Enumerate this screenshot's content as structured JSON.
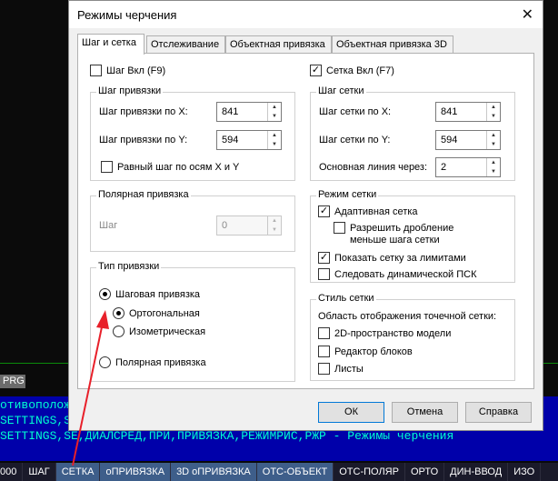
{
  "background": {
    "prg_tab": "PRG",
    "cmd_lines": [
      "отивополож",
      "SETTINGS,SE",
      "SETTINGS,SЕ,ДИАЛСРЕД,ПРИ,ПРИВЯЗКА,РЕЖИМРИС,РЖР - Режимы черчения"
    ],
    "status_items": [
      {
        "label": "000",
        "active": false
      },
      {
        "label": "ШАГ",
        "active": false
      },
      {
        "label": "СЕТКА",
        "active": true
      },
      {
        "label": "оПРИВЯЗКА",
        "active": true
      },
      {
        "label": "3D оПРИВЯЗКА",
        "active": true
      },
      {
        "label": "ОТС-ОБЪЕКТ",
        "active": true
      },
      {
        "label": "ОТС-ПОЛЯР",
        "active": false
      },
      {
        "label": "ОРТО",
        "active": false
      },
      {
        "label": "ДИН-ВВОД",
        "active": false
      },
      {
        "label": "ИЗО",
        "active": false
      }
    ]
  },
  "dialog": {
    "title": "Режимы черчения",
    "close_icon": "close-icon",
    "tabs": [
      {
        "label": "Шаг и сетка",
        "active": true
      },
      {
        "label": "Отслеживание",
        "active": false
      },
      {
        "label": "Объектная привязка",
        "active": false
      },
      {
        "label": "Объектная привязка 3D",
        "active": false
      }
    ],
    "snap_on": {
      "label": "Шаг Вкл (F9)",
      "checked": false
    },
    "grid_on": {
      "label": "Сетка Вкл (F7)",
      "checked": true
    },
    "snap_group": {
      "title": "Шаг привязки",
      "x_label": "Шаг привязки по X:",
      "x_value": "841",
      "y_label": "Шаг привязки по Y:",
      "y_value": "594",
      "equal_label": "Равный шаг по осям X и Y",
      "equal_checked": false
    },
    "grid_group": {
      "title": "Шаг сетки",
      "x_label": "Шаг сетки по X:",
      "x_value": "841",
      "y_label": "Шаг сетки по Y:",
      "y_value": "594",
      "major_label": "Основная линия через:",
      "major_value": "2"
    },
    "polar_group": {
      "title": "Полярная привязка",
      "step_label": "Шаг",
      "step_value": "0"
    },
    "grid_mode": {
      "title": "Режим сетки",
      "adaptive": {
        "label": "Адаптивная сетка",
        "checked": true
      },
      "subdivide_line1": "Разрешить дробление",
      "subdivide_line2": "меньше шага сетки",
      "subdivide_checked": false,
      "limits": {
        "label": "Показать сетку за лимитами",
        "checked": true
      },
      "follow_ucs": {
        "label": "Следовать динамической ПСК",
        "checked": false
      }
    },
    "snap_type": {
      "title": "Тип привязки",
      "grid_snap": {
        "label": "Шаговая привязка",
        "selected": true
      },
      "rectangular": {
        "label": "Ортогональная",
        "selected": true
      },
      "isometric": {
        "label": "Изометрическая",
        "selected": false
      },
      "polar": {
        "label": "Полярная привязка",
        "selected": false
      }
    },
    "grid_style": {
      "title": "Стиль сетки",
      "caption": "Область отображения точечной сетки:",
      "model": {
        "label": "2D-пространство модели",
        "checked": false
      },
      "block_editor": {
        "label": "Редактор блоков",
        "checked": false
      },
      "sheets": {
        "label": "Листы",
        "checked": false
      }
    },
    "buttons": {
      "ok": "ОК",
      "cancel": "Отмена",
      "help": "Справка"
    }
  },
  "colors": {
    "annotation_arrow": "#e8202a",
    "cmd_background": "#0000aa",
    "cmd_text": "#00ffd0"
  }
}
